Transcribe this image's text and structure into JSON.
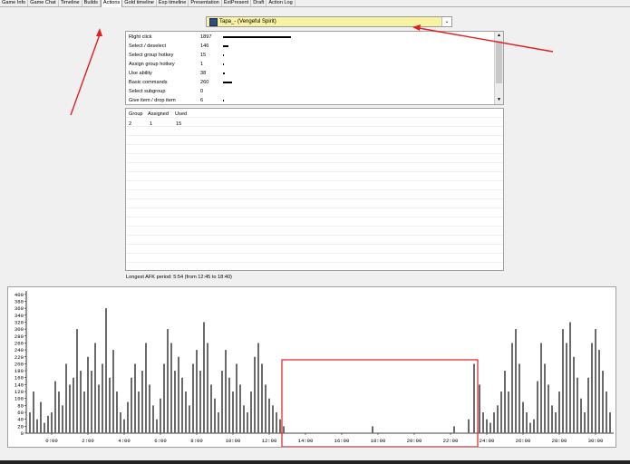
{
  "tabs": [
    {
      "label": "Game Info"
    },
    {
      "label": "Game Chat"
    },
    {
      "label": "Timeline"
    },
    {
      "label": "Builds"
    },
    {
      "label": "Actions",
      "active": true
    },
    {
      "label": "Gold timeline"
    },
    {
      "label": "Exp timeline"
    },
    {
      "label": "Presentation"
    },
    {
      "label": "ExtPresent"
    },
    {
      "label": "Draft"
    },
    {
      "label": "Action Log"
    }
  ],
  "player_select": {
    "value": "Tapa_- (Vengeful Spirit)"
  },
  "actions": [
    {
      "name": "Right click",
      "count": "1897",
      "value": 1897
    },
    {
      "name": "Select / deselect",
      "count": "146",
      "value": 146
    },
    {
      "name": "Select group hotkey",
      "count": "15",
      "value": 15
    },
    {
      "name": "Assign group hotkey",
      "count": "1",
      "value": 1
    },
    {
      "name": "Use ability",
      "count": "38",
      "value": 38
    },
    {
      "name": "Basic commands",
      "count": "260",
      "value": 260
    },
    {
      "name": "Select subgroup",
      "count": "0",
      "value": 0
    },
    {
      "name": "Give item / drop item",
      "count": "6",
      "value": 6
    }
  ],
  "group_table": {
    "headers": [
      "Group",
      "Assigned",
      "Used"
    ],
    "rows": [
      [
        "2",
        "1",
        "15"
      ]
    ]
  },
  "afk_text": "Longest AFK period: 5:54 (from 12:45 to 18:40)",
  "colors": {
    "bar": "#6a6a6a",
    "highlight": "#e02020",
    "select_bg": "#f7f3a3"
  },
  "chart_data": {
    "type": "bar",
    "y_ticks": [
      0,
      20,
      40,
      60,
      80,
      100,
      120,
      140,
      160,
      180,
      200,
      220,
      240,
      260,
      280,
      300,
      320,
      340,
      360,
      380,
      400
    ],
    "ylim": [
      0,
      410
    ],
    "x_ticks": [
      "0:00",
      "2:00",
      "4:00",
      "6:00",
      "8:00",
      "10:00",
      "12:00",
      "14:00",
      "16:00",
      "18:00",
      "20:00",
      "22:00",
      "24:00",
      "26:00",
      "28:00",
      "30:00"
    ],
    "x_tick_minutes": [
      0,
      2,
      4,
      6,
      8,
      10,
      12,
      14,
      16,
      18,
      20,
      22,
      24,
      26,
      28,
      30
    ],
    "xlim_minutes": [
      -1.4,
      31.0
    ],
    "grid": false,
    "highlight_minutes": [
      12.7,
      23.5
    ],
    "afk_minutes": [
      12.75,
      18.67
    ],
    "bars_by_minute": [
      [
        -1.2,
        60
      ],
      [
        -1.0,
        120
      ],
      [
        -0.8,
        40
      ],
      [
        -0.6,
        90
      ],
      [
        -0.4,
        30
      ],
      [
        -0.2,
        50
      ],
      [
        0.0,
        60
      ],
      [
        0.2,
        150
      ],
      [
        0.4,
        120
      ],
      [
        0.6,
        80
      ],
      [
        0.8,
        200
      ],
      [
        1.0,
        140
      ],
      [
        1.2,
        160
      ],
      [
        1.4,
        300
      ],
      [
        1.6,
        180
      ],
      [
        1.8,
        120
      ],
      [
        2.0,
        220
      ],
      [
        2.2,
        180
      ],
      [
        2.4,
        260
      ],
      [
        2.6,
        140
      ],
      [
        2.8,
        200
      ],
      [
        3.0,
        360
      ],
      [
        3.2,
        160
      ],
      [
        3.4,
        240
      ],
      [
        3.6,
        120
      ],
      [
        3.8,
        60
      ],
      [
        4.0,
        40
      ],
      [
        4.2,
        90
      ],
      [
        4.4,
        160
      ],
      [
        4.6,
        200
      ],
      [
        4.8,
        120
      ],
      [
        5.0,
        180
      ],
      [
        5.2,
        260
      ],
      [
        5.4,
        140
      ],
      [
        5.6,
        80
      ],
      [
        5.8,
        40
      ],
      [
        6.0,
        100
      ],
      [
        6.2,
        200
      ],
      [
        6.4,
        300
      ],
      [
        6.6,
        260
      ],
      [
        6.8,
        180
      ],
      [
        7.0,
        220
      ],
      [
        7.2,
        160
      ],
      [
        7.4,
        120
      ],
      [
        7.6,
        80
      ],
      [
        7.8,
        200
      ],
      [
        8.0,
        240
      ],
      [
        8.2,
        180
      ],
      [
        8.4,
        320
      ],
      [
        8.6,
        260
      ],
      [
        8.8,
        140
      ],
      [
        9.0,
        100
      ],
      [
        9.2,
        60
      ],
      [
        9.4,
        180
      ],
      [
        9.6,
        240
      ],
      [
        9.8,
        160
      ],
      [
        10.0,
        120
      ],
      [
        10.2,
        200
      ],
      [
        10.4,
        140
      ],
      [
        10.6,
        80
      ],
      [
        10.8,
        60
      ],
      [
        11.0,
        120
      ],
      [
        11.2,
        220
      ],
      [
        11.4,
        260
      ],
      [
        11.6,
        200
      ],
      [
        11.8,
        140
      ],
      [
        12.0,
        100
      ],
      [
        12.2,
        80
      ],
      [
        12.4,
        60
      ],
      [
        12.6,
        40
      ],
      [
        12.8,
        20
      ],
      [
        17.7,
        20
      ],
      [
        22.2,
        20
      ],
      [
        23.0,
        40
      ],
      [
        23.3,
        200
      ],
      [
        23.6,
        140
      ],
      [
        23.8,
        60
      ],
      [
        24.0,
        40
      ],
      [
        24.2,
        30
      ],
      [
        24.4,
        60
      ],
      [
        24.6,
        80
      ],
      [
        24.8,
        120
      ],
      [
        25.0,
        180
      ],
      [
        25.2,
        120
      ],
      [
        25.4,
        260
      ],
      [
        25.6,
        300
      ],
      [
        25.8,
        200
      ],
      [
        26.0,
        90
      ],
      [
        26.2,
        60
      ],
      [
        26.4,
        30
      ],
      [
        26.6,
        40
      ],
      [
        26.8,
        150
      ],
      [
        27.0,
        260
      ],
      [
        27.2,
        200
      ],
      [
        27.4,
        140
      ],
      [
        27.6,
        80
      ],
      [
        27.8,
        60
      ],
      [
        28.0,
        120
      ],
      [
        28.2,
        300
      ],
      [
        28.4,
        260
      ],
      [
        28.6,
        320
      ],
      [
        28.8,
        220
      ],
      [
        29.0,
        160
      ],
      [
        29.2,
        100
      ],
      [
        29.4,
        60
      ],
      [
        29.6,
        160
      ],
      [
        29.8,
        260
      ],
      [
        30.0,
        300
      ],
      [
        30.2,
        240
      ],
      [
        30.4,
        180
      ],
      [
        30.6,
        120
      ],
      [
        30.8,
        60
      ]
    ]
  }
}
